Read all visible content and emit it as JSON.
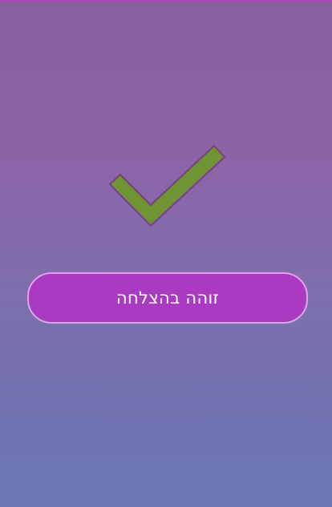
{
  "status": {
    "icon": "checkmark-icon",
    "message": "זוהה בהצלחה"
  },
  "colors": {
    "top_bar": "#b33fc2",
    "checkmark_fill": "#6e9433",
    "checkmark_stroke": "#7b3d85",
    "pill_fill": "#ab3ac3",
    "pill_border": "#e0a3ea",
    "text": "#ffffff"
  }
}
